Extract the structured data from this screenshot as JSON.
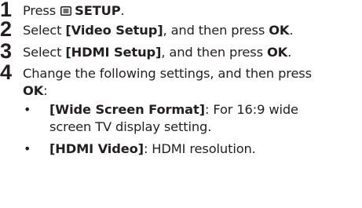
{
  "steps": [
    {
      "number": "1",
      "parts": {
        "a": "Press ",
        "b": "SETUP",
        "c": ".",
        "icon": "setup-icon"
      }
    },
    {
      "number": "2",
      "parts": {
        "a": "Select ",
        "b": "[Video Setup]",
        "c": ", and then press ",
        "d": "OK",
        "e": "."
      }
    },
    {
      "number": "3",
      "parts": {
        "a": "Select ",
        "b": "[HDMI Setup]",
        "c": ", and then press ",
        "d": "OK",
        "e": "."
      }
    },
    {
      "number": "4",
      "parts": {
        "a": "Change the following settings, and then press ",
        "b": "OK",
        "c": ":"
      },
      "bullets": [
        {
          "marker": "•",
          "bold": "[Wide Screen Format]",
          "text": ": For 16:9 wide screen TV display setting."
        },
        {
          "marker": "•",
          "bold": "[HDMI Video]",
          "text": ": HDMI resolution."
        }
      ]
    }
  ]
}
